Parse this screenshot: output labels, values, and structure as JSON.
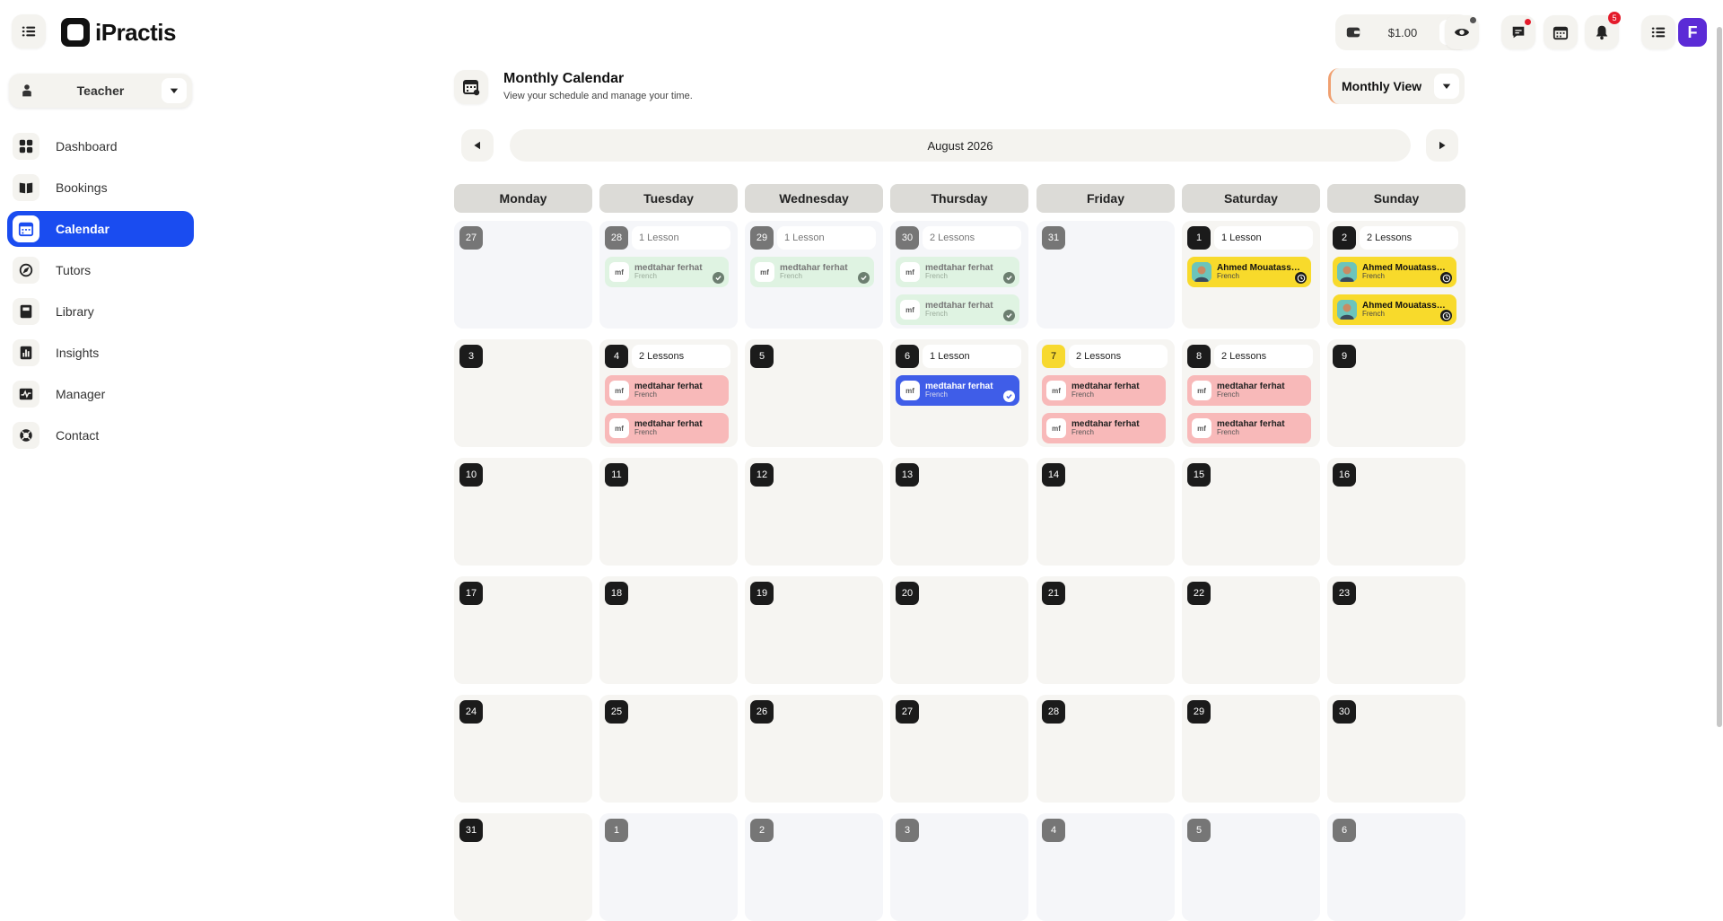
{
  "app": {
    "name": "iPractis"
  },
  "topbar": {
    "wallet_amount": "$1.00",
    "notifications_count": "5"
  },
  "sidebar": {
    "role": "Teacher",
    "items": [
      {
        "label": "Dashboard",
        "icon": "dashboard-icon"
      },
      {
        "label": "Bookings",
        "icon": "book-icon"
      },
      {
        "label": "Calendar",
        "icon": "calendar-icon"
      },
      {
        "label": "Tutors",
        "icon": "compass-icon"
      },
      {
        "label": "Library",
        "icon": "library-icon"
      },
      {
        "label": "Insights",
        "icon": "insights-icon"
      },
      {
        "label": "Manager",
        "icon": "manager-icon"
      },
      {
        "label": "Contact",
        "icon": "lifebuoy-icon"
      }
    ],
    "active_index": 2
  },
  "header": {
    "title": "Monthly Calendar",
    "subtitle": "View your schedule and manage your time.",
    "view_label": "Monthly View",
    "month_label": "August 2026"
  },
  "calendar": {
    "weekdays": [
      "Monday",
      "Tuesday",
      "Wednesday",
      "Thursday",
      "Friday",
      "Saturday",
      "Sunday"
    ],
    "weeks": [
      [
        {
          "day": "27",
          "other": true,
          "count": "",
          "lessons": []
        },
        {
          "day": "28",
          "other": true,
          "count": "1 Lesson",
          "lessons": [
            {
              "initials": "mf",
              "name": "medtahar ferhat",
              "lang": "French",
              "style": "green",
              "status": "check"
            }
          ]
        },
        {
          "day": "29",
          "other": true,
          "count": "1 Lesson",
          "lessons": [
            {
              "initials": "mf",
              "name": "medtahar ferhat",
              "lang": "French",
              "style": "green",
              "status": "check"
            }
          ]
        },
        {
          "day": "30",
          "other": true,
          "count": "2 Lessons",
          "lessons": [
            {
              "initials": "mf",
              "name": "medtahar ferhat",
              "lang": "French",
              "style": "green",
              "status": "check"
            },
            {
              "initials": "mf",
              "name": "medtahar ferhat",
              "lang": "French",
              "style": "green",
              "status": "check"
            }
          ]
        },
        {
          "day": "31",
          "other": true,
          "count": "",
          "lessons": []
        },
        {
          "day": "1",
          "other": false,
          "count": "1 Lesson",
          "lessons": [
            {
              "initials": "",
              "photo": true,
              "name": "Ahmed Mouatassem...",
              "lang": "French",
              "style": "yellow",
              "status": "clock"
            }
          ]
        },
        {
          "day": "2",
          "other": false,
          "count": "2 Lessons",
          "lessons": [
            {
              "initials": "",
              "photo": true,
              "name": "Ahmed Mouatassem...",
              "lang": "French",
              "style": "yellow",
              "status": "clock"
            },
            {
              "initials": "",
              "photo": true,
              "name": "Ahmed Mouatassem...",
              "lang": "French",
              "style": "yellow",
              "status": "clock"
            }
          ]
        }
      ],
      [
        {
          "day": "3",
          "count": "",
          "lessons": []
        },
        {
          "day": "4",
          "count": "2 Lessons",
          "lessons": [
            {
              "initials": "mf",
              "name": "medtahar ferhat",
              "lang": "French",
              "style": "pink"
            },
            {
              "initials": "mf",
              "name": "medtahar ferhat",
              "lang": "French",
              "style": "pink"
            }
          ]
        },
        {
          "day": "5",
          "count": "",
          "lessons": []
        },
        {
          "day": "6",
          "count": "1 Lesson",
          "lessons": [
            {
              "initials": "mf",
              "name": "medtahar ferhat",
              "lang": "French",
              "style": "blue",
              "status": "check"
            }
          ]
        },
        {
          "day": "7",
          "today": true,
          "count": "2 Lessons",
          "lessons": [
            {
              "initials": "mf",
              "name": "medtahar ferhat",
              "lang": "French",
              "style": "pink"
            },
            {
              "initials": "mf",
              "name": "medtahar ferhat",
              "lang": "French",
              "style": "pink"
            }
          ]
        },
        {
          "day": "8",
          "count": "2 Lessons",
          "lessons": [
            {
              "initials": "mf",
              "name": "medtahar ferhat",
              "lang": "French",
              "style": "pink"
            },
            {
              "initials": "mf",
              "name": "medtahar ferhat",
              "lang": "French",
              "style": "pink"
            }
          ]
        },
        {
          "day": "9",
          "count": "",
          "lessons": []
        }
      ],
      [
        {
          "day": "10",
          "count": "",
          "lessons": []
        },
        {
          "day": "11",
          "count": "",
          "lessons": []
        },
        {
          "day": "12",
          "count": "",
          "lessons": []
        },
        {
          "day": "13",
          "count": "",
          "lessons": []
        },
        {
          "day": "14",
          "count": "",
          "lessons": []
        },
        {
          "day": "15",
          "count": "",
          "lessons": []
        },
        {
          "day": "16",
          "count": "",
          "lessons": []
        }
      ],
      [
        {
          "day": "17",
          "count": "",
          "lessons": []
        },
        {
          "day": "18",
          "count": "",
          "lessons": []
        },
        {
          "day": "19",
          "count": "",
          "lessons": []
        },
        {
          "day": "20",
          "count": "",
          "lessons": []
        },
        {
          "day": "21",
          "count": "",
          "lessons": []
        },
        {
          "day": "22",
          "count": "",
          "lessons": []
        },
        {
          "day": "23",
          "count": "",
          "lessons": []
        }
      ],
      [
        {
          "day": "24",
          "count": "",
          "lessons": []
        },
        {
          "day": "25",
          "count": "",
          "lessons": []
        },
        {
          "day": "26",
          "count": "",
          "lessons": []
        },
        {
          "day": "27",
          "count": "",
          "lessons": []
        },
        {
          "day": "28",
          "count": "",
          "lessons": []
        },
        {
          "day": "29",
          "count": "",
          "lessons": []
        },
        {
          "day": "30",
          "count": "",
          "lessons": []
        }
      ],
      [
        {
          "day": "31",
          "count": "",
          "lessons": []
        },
        {
          "day": "1",
          "other": true,
          "count": "",
          "lessons": []
        },
        {
          "day": "2",
          "other": true,
          "count": "",
          "lessons": []
        },
        {
          "day": "3",
          "other": true,
          "count": "",
          "lessons": []
        },
        {
          "day": "4",
          "other": true,
          "count": "",
          "lessons": []
        },
        {
          "day": "5",
          "other": true,
          "count": "",
          "lessons": []
        },
        {
          "day": "6",
          "other": true,
          "count": "",
          "lessons": []
        }
      ]
    ]
  },
  "colors": {
    "accent": "#1a4cf0",
    "today": "#f7d92f",
    "lesson_green": "#dff3e2",
    "lesson_pink": "#f8b9b9",
    "lesson_blue": "#3f5de8",
    "lesson_yellow": "#f8da2b",
    "badge_red": "#e41b2b",
    "avatar_purple": "#5b2bd6"
  }
}
